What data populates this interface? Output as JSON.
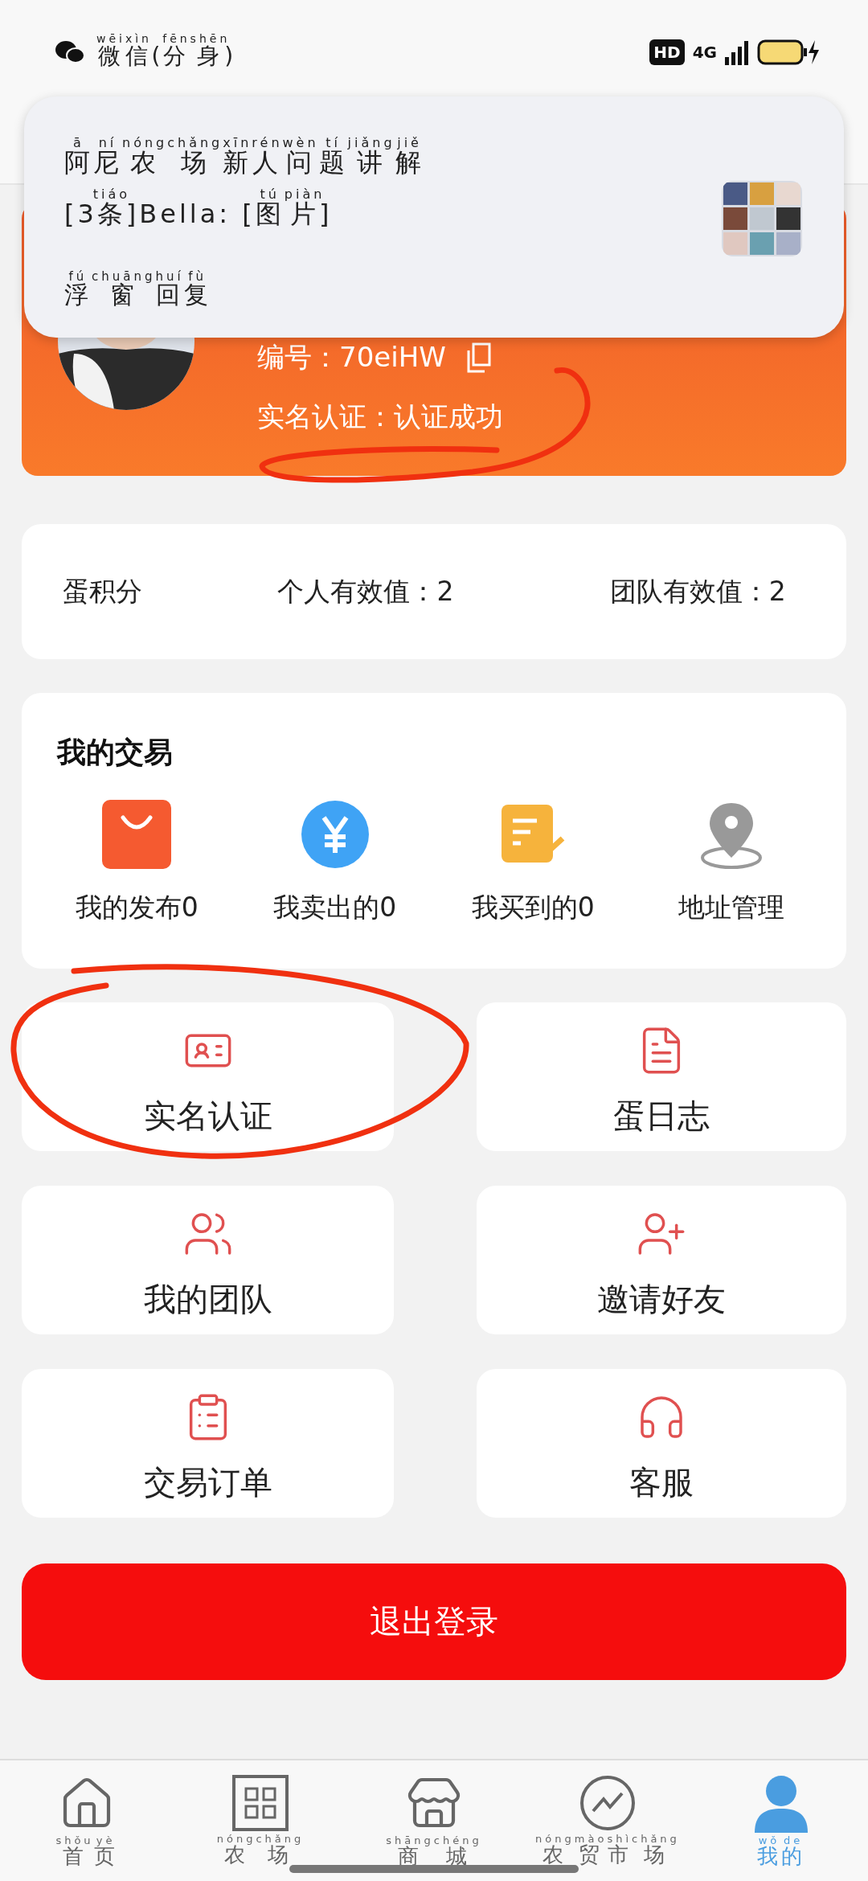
{
  "status_bar": {
    "app": {
      "ruby": [
        [
          "wēi",
          "微"
        ],
        [
          "xìn",
          "信"
        ],
        [
          "("
        ],
        [
          "fēn",
          "分"
        ],
        [
          "shēn",
          "身"
        ],
        [
          ")"
        ]
      ]
    },
    "hd": "HD",
    "network": "4G"
  },
  "notification": {
    "title": {
      "ruby": [
        [
          "ā",
          "阿"
        ],
        [
          "ní",
          "尼"
        ],
        [
          "nóng",
          "农"
        ],
        [
          "chǎng",
          "场"
        ],
        [
          "xīn",
          "新"
        ],
        [
          "rén",
          "人"
        ],
        [
          "wèn",
          "问"
        ],
        [
          "tí",
          "题"
        ],
        [
          "jiǎng",
          "讲"
        ],
        [
          "jiě",
          "解"
        ]
      ]
    },
    "message": {
      "ruby": [
        [
          "[3"
        ],
        [
          "tiáo",
          "条"
        ],
        [
          "]Bella: ["
        ],
        [
          "tú",
          "图"
        ],
        [
          "piàn",
          "片"
        ],
        [
          "]"
        ]
      ]
    },
    "action": {
      "ruby": [
        [
          "fú",
          "浮"
        ],
        [
          "chuāng",
          "窗"
        ],
        [
          "huí",
          "回"
        ],
        [
          "fù",
          "复"
        ]
      ]
    }
  },
  "profile": {
    "id_label": "编号：70eiHW",
    "verification": "实名认证：认证成功"
  },
  "stats": [
    "蛋积分",
    "个人有效值：2",
    "团队有效值：2"
  ],
  "trade": {
    "title": "我的交易",
    "items": [
      {
        "label": "我的发布0",
        "kind": "bag"
      },
      {
        "label": "我卖出的0",
        "kind": "yen"
      },
      {
        "label": "我买到的0",
        "kind": "receipt"
      },
      {
        "label": "地址管理",
        "kind": "location"
      }
    ]
  },
  "tiles": [
    {
      "label": "实名认证",
      "kind": "id-card"
    },
    {
      "label": "蛋日志",
      "kind": "log"
    },
    {
      "label": "我的团队",
      "kind": "team"
    },
    {
      "label": "邀请好友",
      "kind": "invite"
    },
    {
      "label": "交易订单",
      "kind": "orders"
    },
    {
      "label": "客服",
      "kind": "support"
    }
  ],
  "logout": "退出登录",
  "tabs": [
    {
      "kind": "home",
      "selected": false,
      "label": {
        "ruby": [
          [
            "shǒu",
            "首"
          ],
          [
            "yè",
            "页"
          ]
        ]
      }
    },
    {
      "kind": "farm",
      "selected": false,
      "label": {
        "ruby": [
          [
            "nóng",
            "农"
          ],
          [
            "chǎng",
            "场"
          ]
        ]
      }
    },
    {
      "kind": "mall",
      "selected": false,
      "label": {
        "ruby": [
          [
            "shāng",
            "商"
          ],
          [
            "chéng",
            "城"
          ]
        ]
      }
    },
    {
      "kind": "market",
      "selected": false,
      "label": {
        "ruby": [
          [
            "nóng",
            "农"
          ],
          [
            "mào",
            "贸"
          ],
          [
            "shì",
            "市"
          ],
          [
            "chǎng",
            "场"
          ]
        ]
      }
    },
    {
      "kind": "me",
      "selected": true,
      "label": {
        "ruby": [
          [
            "wǒ",
            "我"
          ],
          [
            "de",
            "的"
          ]
        ]
      }
    }
  ]
}
